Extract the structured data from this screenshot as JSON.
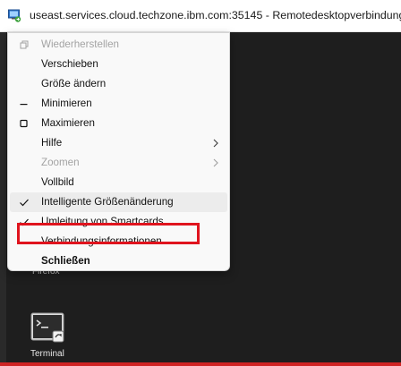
{
  "window": {
    "title": "useast.services.cloud.techzone.ibm.com:35145 - Remotedesktopverbindung",
    "app_icon": "remote-desktop-icon"
  },
  "menu": {
    "items": [
      {
        "label": "Wiederherstellen",
        "state": "disabled",
        "icon": "restore-icon"
      },
      {
        "label": "Verschieben"
      },
      {
        "label": "Größe ändern"
      },
      {
        "label": "Minimieren",
        "icon": "minimize-icon"
      },
      {
        "label": "Maximieren",
        "icon": "maximize-icon"
      },
      {
        "label": "Hilfe",
        "submenu": true
      },
      {
        "label": "Zoomen",
        "state": "disabled",
        "submenu": true
      },
      {
        "label": "Vollbild"
      },
      {
        "label": "Intelligente Größenänderung",
        "checked": true,
        "highlighted": true
      },
      {
        "label": "Umleitung von Smartcards",
        "checked": true
      },
      {
        "label": "Verbindungsinformationen"
      },
      {
        "label": "Schließen",
        "bold": true
      }
    ]
  },
  "annotation": {
    "highlight_color": "#e0141e"
  },
  "desktop": {
    "icons": [
      {
        "label": "Firefox",
        "icon": "firefox-icon"
      },
      {
        "label": "Terminal",
        "icon": "terminal-icon"
      }
    ]
  }
}
